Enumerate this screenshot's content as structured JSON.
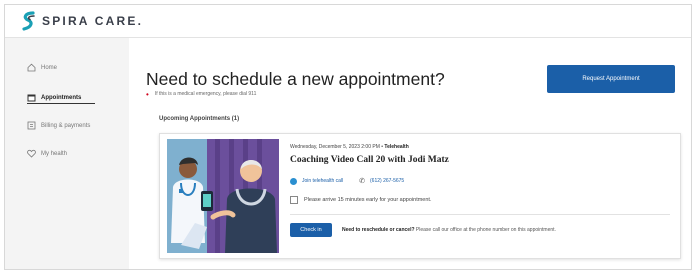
{
  "header": {
    "brand": "SPIRA CARE."
  },
  "sidebar": {
    "items": [
      {
        "label": "Home",
        "icon": "home-icon"
      },
      {
        "label": "Appointments",
        "icon": "calendar-icon",
        "active": true
      },
      {
        "label": "Billing & payments",
        "icon": "billing-icon"
      },
      {
        "label": "My health",
        "icon": "heart-icon"
      }
    ]
  },
  "main": {
    "title": "Need to schedule a new appointment?",
    "emergency_note": "If this is a medical emergency, please dial 911",
    "request_button": "Request Appointment",
    "upcoming_heading": "Upcoming Appointments (1)",
    "appointment": {
      "date": "Wednesday, December 5, 2023 2:00 PM",
      "type": "Telehealth",
      "title": "Coaching Video Call 20 with Jodi Matz",
      "video_link": "Join telehealth call",
      "phone": "(612) 267-5675",
      "arrive_note": "Please arrive 15 minutes early for your appointment.",
      "checkin_button": "Check in",
      "reschedule_label": "Need to reschedule or cancel?",
      "reschedule_text": "Please call our office at the phone number on this appointment."
    }
  },
  "colors": {
    "primary": "#1b5fa8",
    "accent_red": "#d0021b",
    "brand_teal": "#1aa0b5"
  }
}
